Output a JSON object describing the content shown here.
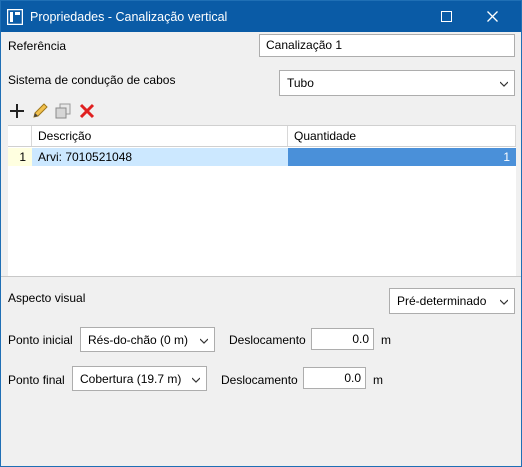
{
  "window": {
    "title": "Propriedades - Canalização vertical",
    "colors": {
      "titlebar": "#0a5ba6",
      "selection": "#cce8ff",
      "selected_value": "#4a90d9",
      "delete": "#e02020"
    }
  },
  "reference": {
    "label": "Referência",
    "value": "Canalização 1"
  },
  "cable_system": {
    "label": "Sistema de condução de cabos",
    "selected": "Tubo"
  },
  "toolbar": {
    "add_icon": "plus-icon",
    "edit_icon": "pencil-icon",
    "copy_icon": "copy-icon",
    "delete_icon": "x-icon"
  },
  "table": {
    "columns": [
      "Descrição",
      "Quantidade"
    ],
    "rows": [
      {
        "index": "1",
        "description": "Arvi: 7010521048",
        "quantity": "1"
      }
    ]
  },
  "visual": {
    "label": "Aspecto visual",
    "selected": "Pré-determinado"
  },
  "start_point": {
    "label": "Ponto inicial",
    "selected": "Rés-do-chão (0 m)",
    "offset_label": "Deslocamento",
    "offset_value": "0.0",
    "unit": "m"
  },
  "end_point": {
    "label": "Ponto final",
    "selected": "Cobertura (19.7 m)",
    "offset_label": "Deslocamento",
    "offset_value": "0.0",
    "unit": "m"
  }
}
